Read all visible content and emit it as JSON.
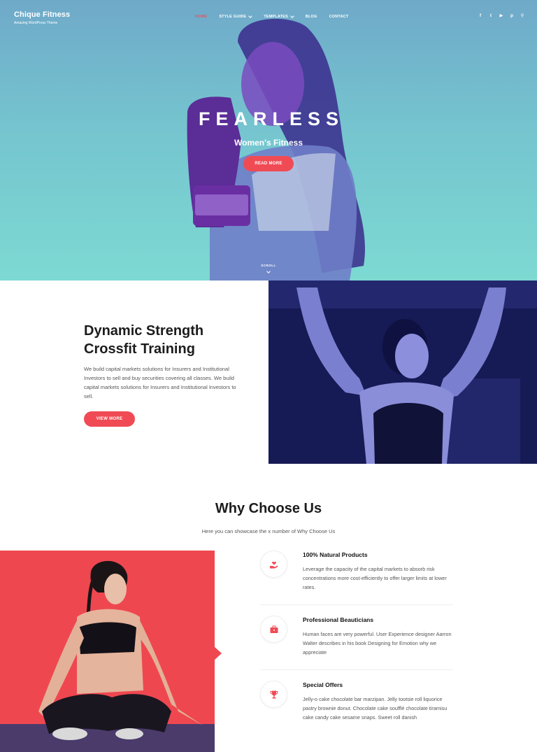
{
  "site": {
    "title": "Chique Fitness",
    "tagline": "Amazing WordPress Theme"
  },
  "nav": {
    "items": [
      {
        "label": "HOME",
        "active": true,
        "dropdown": false
      },
      {
        "label": "STYLE GUIDE",
        "active": false,
        "dropdown": true
      },
      {
        "label": "TEMPLATES",
        "active": false,
        "dropdown": true
      },
      {
        "label": "BLOG",
        "active": false,
        "dropdown": false
      },
      {
        "label": "CONTACT",
        "active": false,
        "dropdown": false
      }
    ]
  },
  "social": [
    {
      "icon": "facebook-icon",
      "glyph": "f"
    },
    {
      "icon": "twitter-icon",
      "glyph": "t"
    },
    {
      "icon": "youtube-icon",
      "glyph": "▶"
    },
    {
      "icon": "pinterest-icon",
      "glyph": "p"
    },
    {
      "icon": "search-icon",
      "glyph": "⚲"
    }
  ],
  "hero": {
    "title": "FEARLESS",
    "subtitle": "Women's Fitness",
    "button": "READ MORE",
    "scroll": "SCROLL"
  },
  "strength": {
    "title": "Dynamic Strength Crossfit Training",
    "text": "We build capital markets solutions for Insurers and Institutional Investors to sell and buy securities covering all classes. We build capital markets solutions for Insurers and Institutional Investors to sell.",
    "button": "VIEW MORE"
  },
  "why": {
    "title": "Why Choose Us",
    "subtitle": "Here you can showcase the x number of Why Choose Us",
    "features": [
      {
        "icon": "hand-heart-icon",
        "title": "100% Natural Products",
        "text": "Leverage the capacity of the capital markets to absorb risk concentrations more cost-efficiently to offer larger limits at lower rates."
      },
      {
        "icon": "briefcase-icon",
        "title": "Professional Beauticians",
        "text": "Human faces are very powerful. User Experience designer Aarron Walter describes in his book Designing for Emotion why we appreciate"
      },
      {
        "icon": "trophy-icon",
        "title": "Special Offers",
        "text": "Jelly-o cake chocolate bar marzipan. Jelly tootsie roll liquorice pastry brownie donut. Chocolate cake soufflé chocolate tiramisu cake candy cake sesame snaps. Sweet roll danish"
      }
    ]
  },
  "colors": {
    "accent": "#f04b55",
    "hero_top": "#6fa9c9",
    "hero_bottom": "#7dd9d2",
    "duotone": "#1a1d5c"
  }
}
